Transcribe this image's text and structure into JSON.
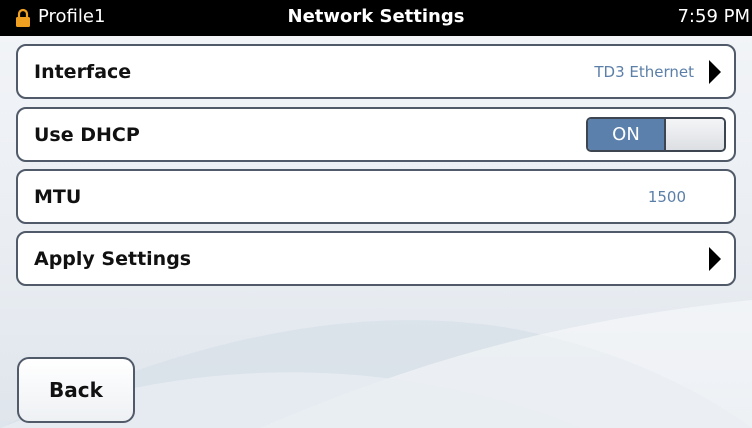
{
  "status_bar": {
    "profile": "Profile1",
    "title": "Network Settings",
    "time": "7:59 PM",
    "lock_icon": "lock-icon"
  },
  "settings": {
    "interface": {
      "label": "Interface",
      "value": "TD3 Ethernet",
      "icon": "chevron-right-icon"
    },
    "dhcp": {
      "label": "Use DHCP",
      "toggle_state": "ON",
      "enabled": true
    },
    "mtu": {
      "label": "MTU",
      "value": "1500"
    },
    "apply": {
      "label": "Apply Settings",
      "icon": "chevron-right-icon"
    }
  },
  "footer": {
    "back_label": "Back"
  },
  "colors": {
    "accent": "#5a80ab",
    "value_text": "#5b7fa8",
    "status_bar_bg": "#000000",
    "lock": "#f0a020"
  }
}
